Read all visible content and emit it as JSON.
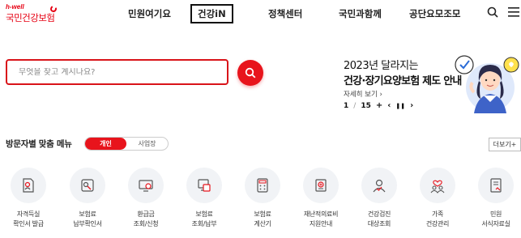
{
  "logo": {
    "tagline": "h-well",
    "name": "국민건강보험"
  },
  "nav": {
    "items": [
      {
        "label": "민원여기요"
      },
      {
        "label": "건강iN"
      },
      {
        "label": "정책센터"
      },
      {
        "label": "국민과함께"
      },
      {
        "label": "공단요모조모"
      }
    ],
    "active_index": 1
  },
  "search": {
    "placeholder": "무엇을 찾고 계시나요?"
  },
  "banner": {
    "title_line1": "2023년 달라지는",
    "title_line2": "건강·장기요양보험 제도 안내",
    "more_link": "자세히 보기 ›",
    "page_current": "1",
    "page_sep": "/",
    "page_total": "15",
    "add": "+",
    "prev": "‹",
    "pause": "❚❚",
    "next": "›"
  },
  "quick_menu": {
    "title": "방문자별 맞춤 메뉴",
    "toggle": {
      "individual": "개인",
      "business": "사업장"
    },
    "more": "더보기+",
    "items": [
      {
        "line1": "자격득실",
        "line2": "확인서 발급",
        "icon": "certificate-icon"
      },
      {
        "line1": "보험료",
        "line2": "납부확인서",
        "icon": "receipt-icon"
      },
      {
        "line1": "환급금",
        "line2": "조회/신청",
        "icon": "refund-monitor-icon"
      },
      {
        "line1": "보험료",
        "line2": "조회/납부",
        "icon": "payment-monitor-icon"
      },
      {
        "line1": "보험료",
        "line2": "계산기",
        "icon": "calculator-icon"
      },
      {
        "line1": "재난적의료비",
        "line2": "지원안내",
        "icon": "medical-support-icon"
      },
      {
        "line1": "건강검진",
        "line2": "대상조회",
        "icon": "checkup-person-icon"
      },
      {
        "line1": "가족",
        "line2": "건강관리",
        "icon": "family-icon"
      },
      {
        "line1": "민원",
        "line2": "서식자료실",
        "icon": "document-form-icon"
      }
    ]
  },
  "colors": {
    "brand_red": "#e8141c",
    "icon_bg": "#f1f3f6"
  }
}
